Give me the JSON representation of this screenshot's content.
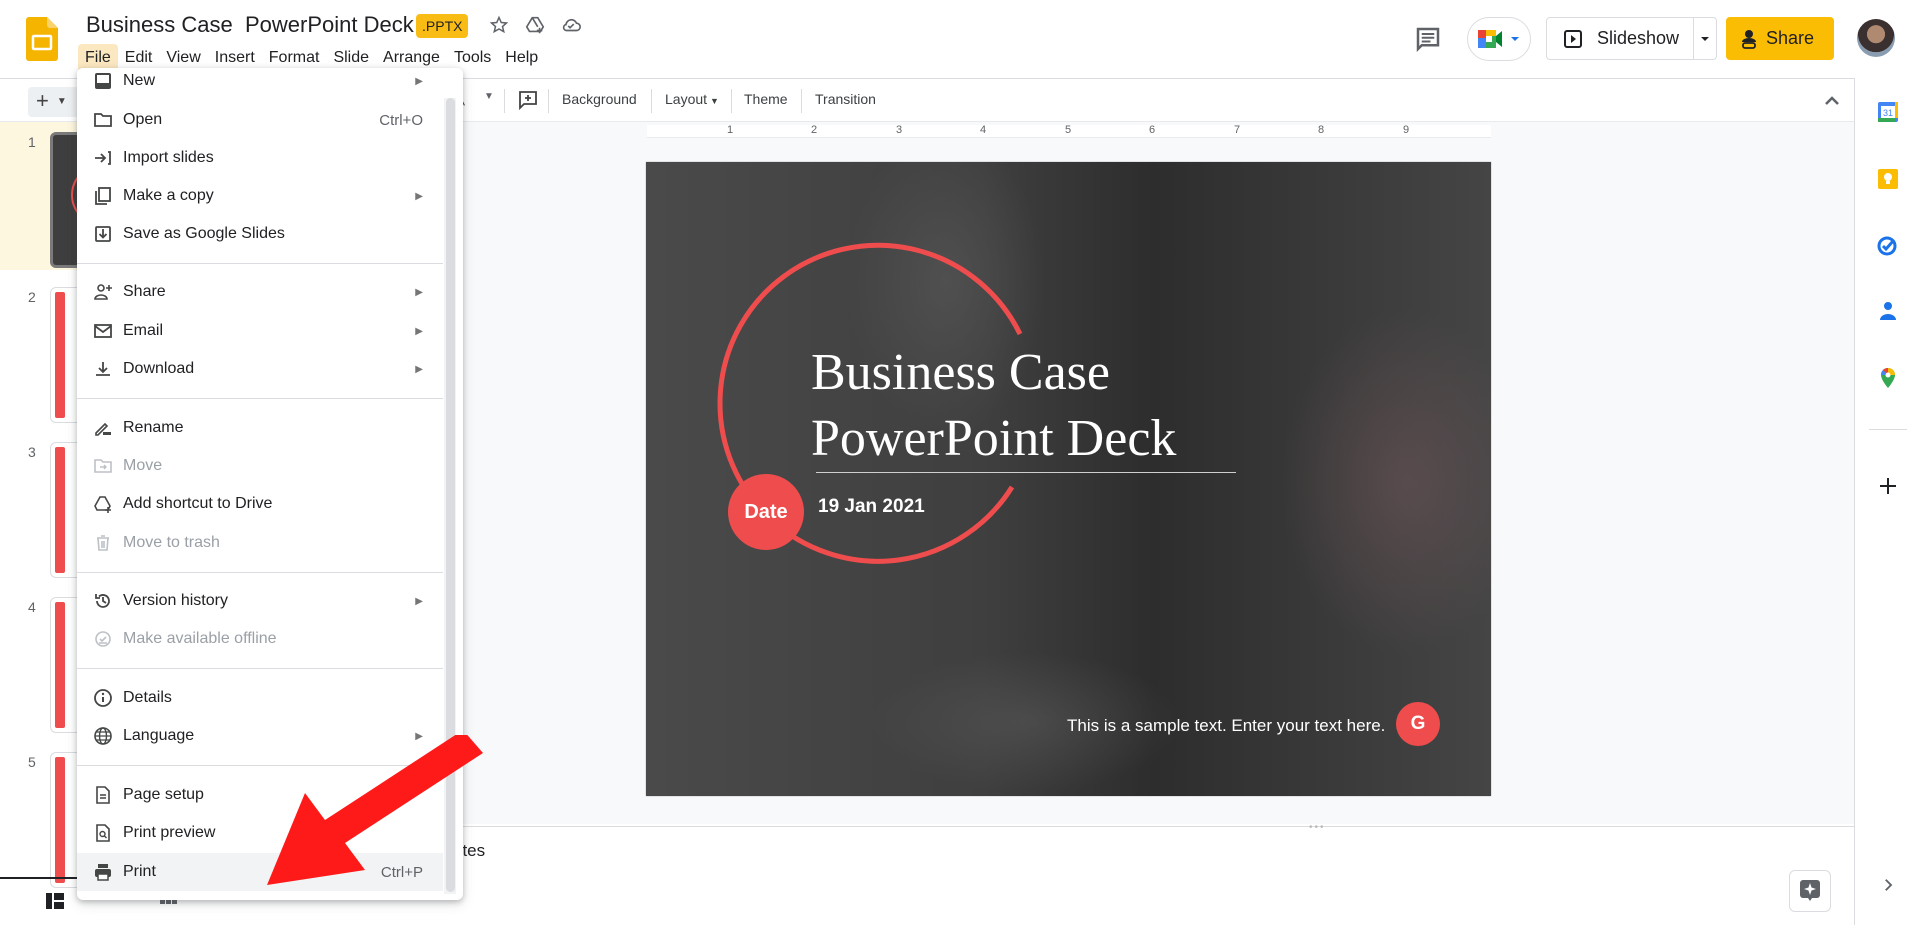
{
  "header": {
    "doc_title": "Business Case  PowerPoint Deck",
    "file_badge": ".PPTX",
    "icons": [
      "star-icon",
      "move-to-drive-icon",
      "cloud-saved-icon"
    ],
    "menus": [
      "File",
      "Edit",
      "View",
      "Insert",
      "Format",
      "Slide",
      "Arrange",
      "Tools",
      "Help"
    ],
    "active_menu": "File",
    "slideshow_label": "Slideshow",
    "share_label": "Share",
    "brand_color": "#fbbc04"
  },
  "toolbar": {
    "background_label": "Background",
    "layout_label": "Layout",
    "theme_label": "Theme",
    "transition_label": "Transition"
  },
  "ruler": {
    "numbers": [
      "1",
      "2",
      "3",
      "4",
      "5",
      "6",
      "7",
      "8",
      "9"
    ]
  },
  "filmstrip": {
    "slides": [
      {
        "number": "1",
        "selected": true
      },
      {
        "number": "2",
        "selected": false
      },
      {
        "number": "3",
        "selected": false
      },
      {
        "number": "4",
        "selected": false
      },
      {
        "number": "5",
        "selected": false
      }
    ]
  },
  "slide": {
    "title": "Business Case\nPowerPoint Deck",
    "date_badge": "Date",
    "date_text": "19 Jan 2021",
    "sample_text": "This is a sample text. Enter your text here.",
    "logo_letter": "G",
    "accent_color": "#ef4d4d"
  },
  "notes": {
    "label": "otes"
  },
  "file_menu": {
    "items": [
      {
        "label": "New",
        "icon": "new-slides-icon",
        "submenu": true
      },
      {
        "label": "Open",
        "icon": "folder-icon",
        "shortcut": "Ctrl+O"
      },
      {
        "label": "Import slides",
        "icon": "import-icon"
      },
      {
        "label": "Make a copy",
        "icon": "copy-icon",
        "submenu": true
      },
      {
        "label": "Save as Google Slides",
        "icon": "save-as-icon"
      },
      {
        "label": "Share",
        "icon": "share-person-icon",
        "submenu": true
      },
      {
        "label": "Email",
        "icon": "email-icon",
        "submenu": true
      },
      {
        "label": "Download",
        "icon": "download-icon",
        "submenu": true
      },
      {
        "label": "Rename",
        "icon": "rename-icon"
      },
      {
        "label": "Move",
        "icon": "move-folder-icon",
        "disabled": true
      },
      {
        "label": "Add shortcut to Drive",
        "icon": "drive-shortcut-icon"
      },
      {
        "label": "Move to trash",
        "icon": "trash-icon",
        "disabled": true
      },
      {
        "label": "Version history",
        "icon": "history-icon",
        "submenu": true
      },
      {
        "label": "Make available offline",
        "icon": "offline-icon",
        "disabled": true
      },
      {
        "label": "Details",
        "icon": "info-icon"
      },
      {
        "label": "Language",
        "icon": "globe-icon",
        "submenu": true
      },
      {
        "label": "Page setup",
        "icon": "page-setup-icon"
      },
      {
        "label": "Print preview",
        "icon": "print-preview-icon"
      },
      {
        "label": "Print",
        "icon": "printer-icon",
        "shortcut": "Ctrl+P",
        "highlighted": true
      }
    ]
  },
  "side_panel": {
    "apps": [
      "calendar-icon",
      "keep-icon",
      "tasks-icon",
      "contacts-icon",
      "maps-icon",
      "add-icon"
    ]
  },
  "annotation": {
    "arrow_color": "#ff1a1a",
    "points_to": "Print"
  }
}
